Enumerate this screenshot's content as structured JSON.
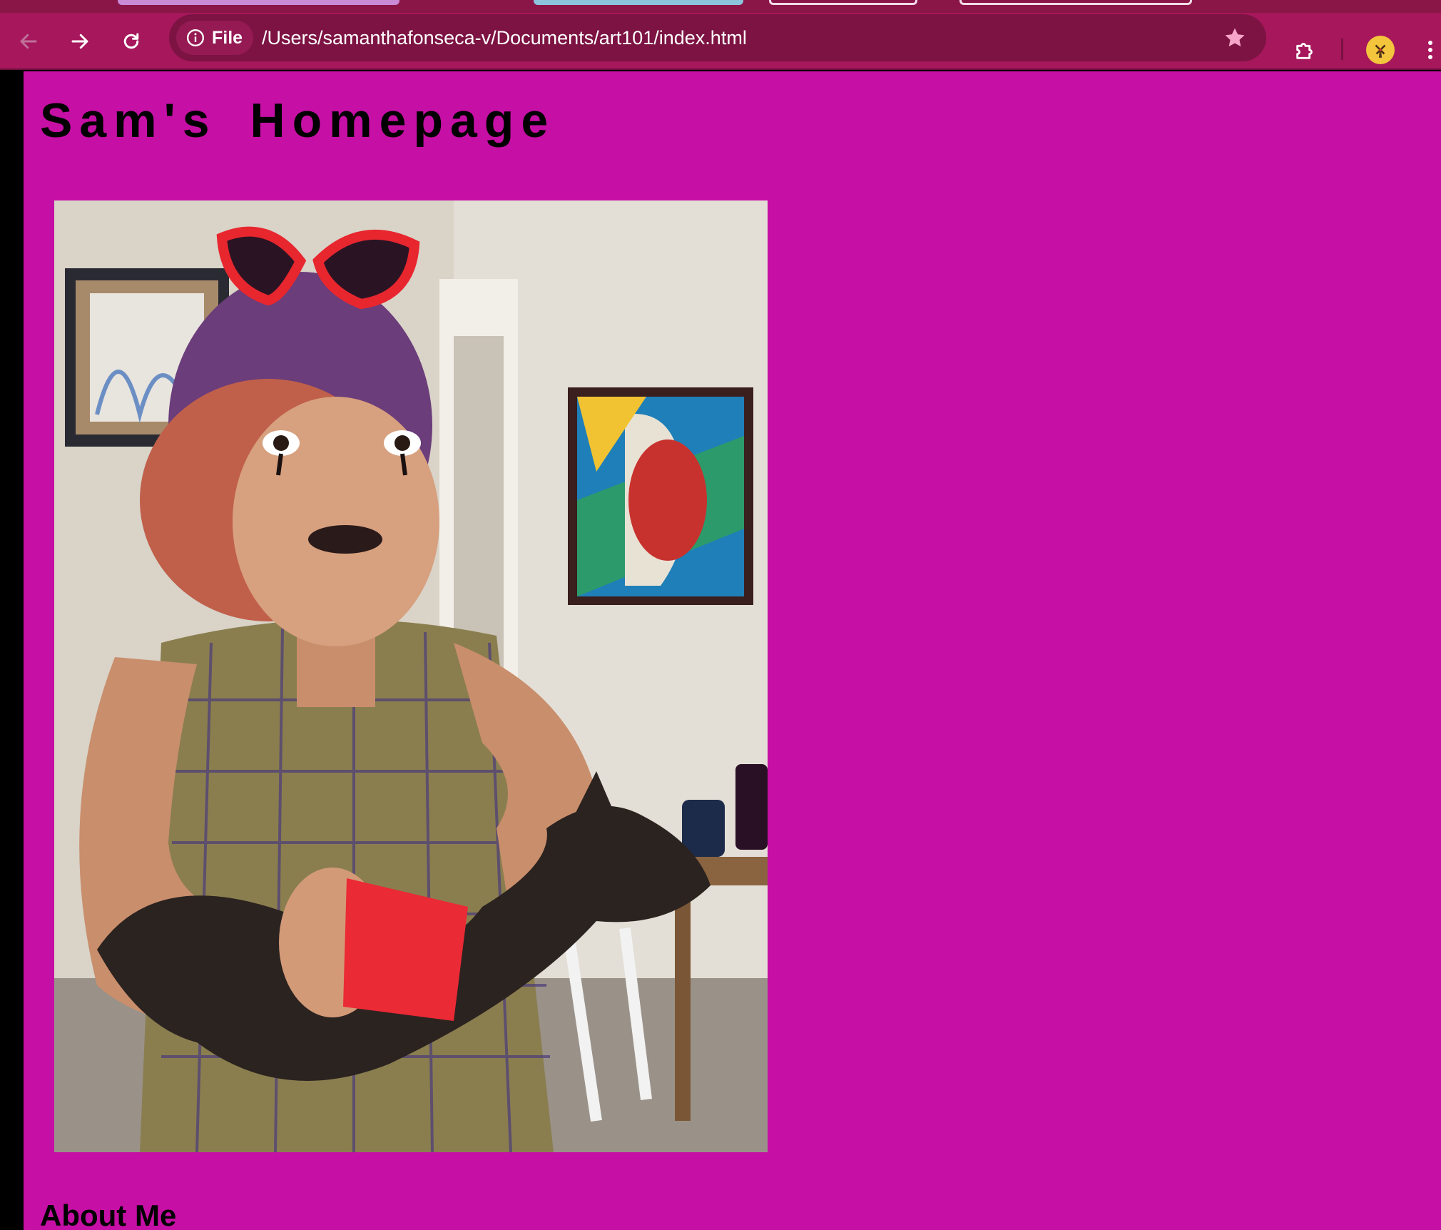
{
  "browser": {
    "site_chip_label": "File",
    "url": "/Users/samanthafonseca-v/Documents/art101/index.html",
    "icons": {
      "back": "arrow-left-icon",
      "forward": "arrow-right-icon",
      "reload": "reload-icon",
      "site_info": "info-icon",
      "bookmark": "star-icon",
      "extensions": "puzzle-piece-icon",
      "profile": "profile-avatar-icon",
      "menu": "kebab-menu-icon"
    },
    "colors": {
      "toolbar": "#a6175c",
      "omnibox": "#7c1342",
      "bookmark_star": "#f6a4c8"
    }
  },
  "page": {
    "title": "Sam's Homepage",
    "photo_alt": "Sam holding a tortoiseshell cat",
    "about_heading": "About Me",
    "colors": {
      "background": "#c60fa5",
      "text": "#000000"
    }
  }
}
